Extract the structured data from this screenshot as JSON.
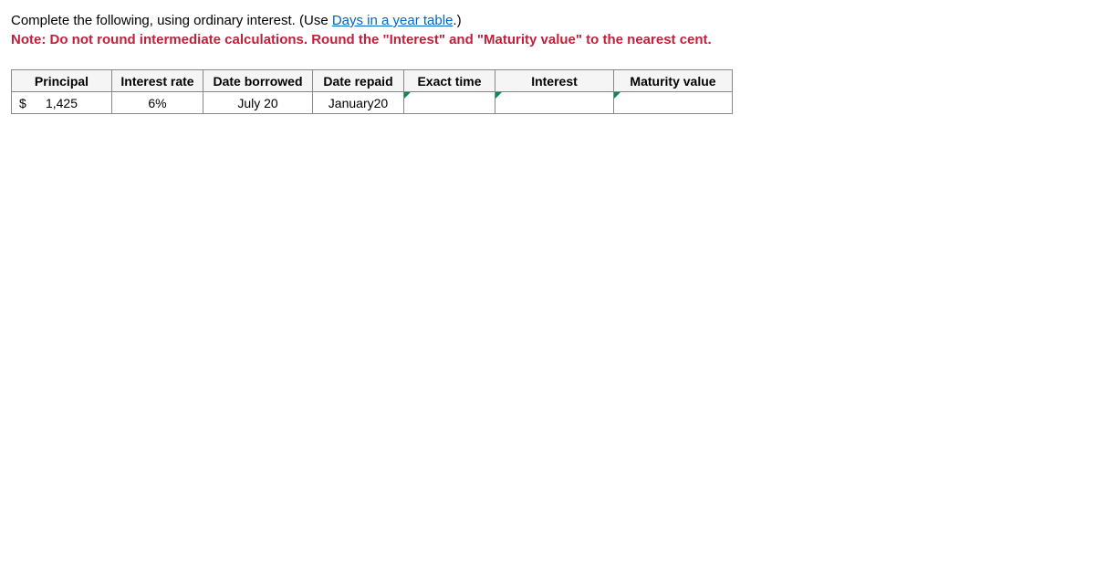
{
  "instructions": {
    "line1_prefix": "Complete the following, using ordinary interest. (Use ",
    "link_text": "Days in a year table",
    "line1_suffix": ".)",
    "note_label": "Note: ",
    "note_text": "Do not round intermediate calculations. Round the \"Interest\" and \"Maturity value\" to the nearest cent."
  },
  "table": {
    "headers": {
      "principal": "Principal",
      "interest_rate": "Interest rate",
      "date_borrowed": "Date borrowed",
      "date_repaid": "Date repaid",
      "exact_time": "Exact time",
      "interest": "Interest",
      "maturity_value": "Maturity value"
    },
    "row": {
      "currency_symbol": "$",
      "principal": "1,425",
      "interest_rate": "6%",
      "date_borrowed": "July 20",
      "date_repaid": "January20",
      "exact_time": "",
      "interest": "",
      "maturity_value": ""
    }
  }
}
